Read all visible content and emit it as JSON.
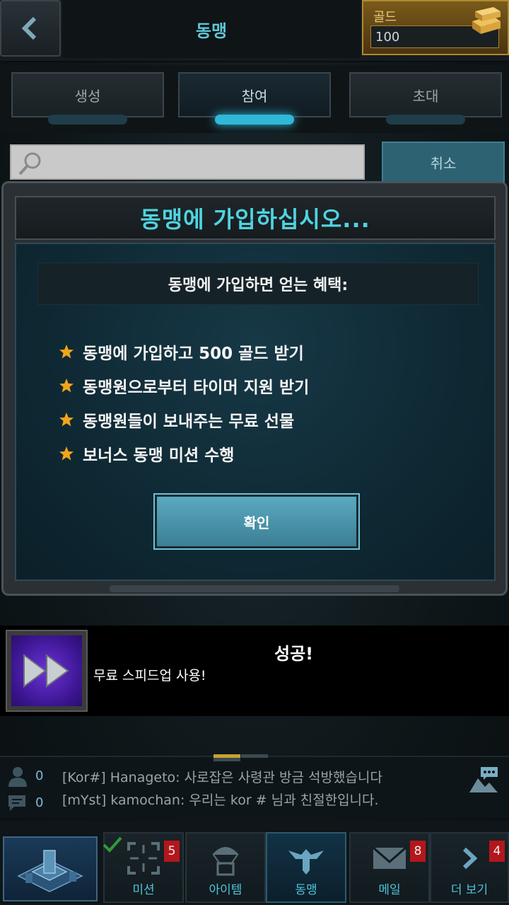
{
  "header": {
    "title": "동맹",
    "gold_label": "골드",
    "gold_value": "100"
  },
  "tabs": [
    {
      "label": "생성",
      "active": false
    },
    {
      "label": "참여",
      "active": true
    },
    {
      "label": "초대",
      "active": false
    }
  ],
  "search": {
    "placeholder": "",
    "cancel_label": "취소"
  },
  "modal": {
    "title": "동맹에 가입하십시오...",
    "benefits_header": "동맹에 가입하면 얻는 혜택:",
    "benefits": [
      "동맹에 가입하고 500 골드 받기",
      "동맹원으로부터 타이머 지원 받기",
      "동맹원들이 보내주는 무료 선물",
      "보너스 동맹 미션 수행"
    ],
    "confirm_label": "확인"
  },
  "toast": {
    "title": "성공!",
    "message": "무료 스피드업 사용!"
  },
  "chat": {
    "user_count": "0",
    "message_count": "0",
    "lines": [
      "[Kor#] Hanageto: 사로잡은 사령관 방금 석방했습니다",
      "[mYst] kamochan: 우리는 kor # 님과 친절한입니다."
    ]
  },
  "nav": [
    {
      "label": "미션",
      "badge": "5",
      "icon": "target-icon"
    },
    {
      "label": "아이템",
      "badge": "",
      "icon": "parachute-crate-icon"
    },
    {
      "label": "동맹",
      "badge": "",
      "icon": "eagle-emblem-icon"
    },
    {
      "label": "메일",
      "badge": "8",
      "icon": "envelope-icon"
    },
    {
      "label": "더 보기",
      "badge": "4",
      "icon": "chevron-right-icon"
    }
  ],
  "colors": {
    "accent_cyan": "#4fd4e0",
    "gold": "#b08a2e",
    "badge_red": "#b3171d",
    "star": "#f2a51a"
  }
}
